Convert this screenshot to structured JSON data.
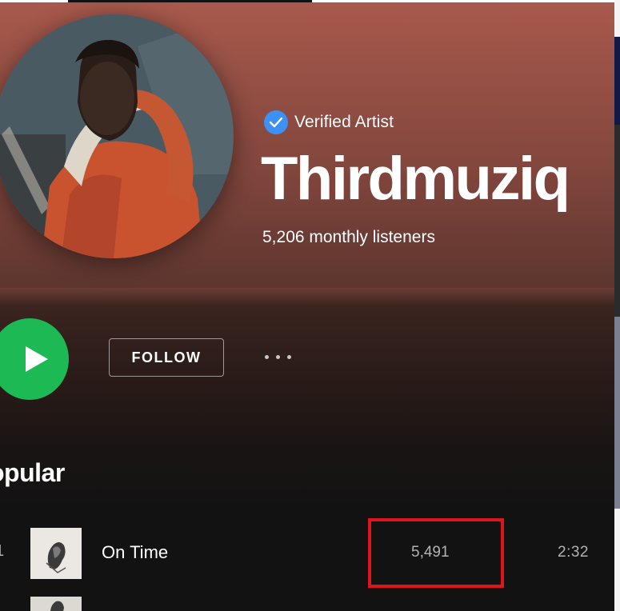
{
  "artist": {
    "verified_label": "Verified Artist",
    "name": "Thirdmuziq",
    "monthly_listeners": "5,206 monthly listeners"
  },
  "actions": {
    "follow_label": "FOLLOW"
  },
  "popular": {
    "heading": "opular",
    "tracks": [
      {
        "number": "1",
        "title": "On Time",
        "plays": "5,491",
        "duration": "2:32"
      }
    ]
  },
  "colors": {
    "header_top": "#a8594c",
    "play_green": "#1db954",
    "verified_blue": "#3d91f4",
    "highlight_red": "#e0141b"
  },
  "icons": [
    "verified-badge-icon",
    "play-icon",
    "more-options-icon"
  ]
}
